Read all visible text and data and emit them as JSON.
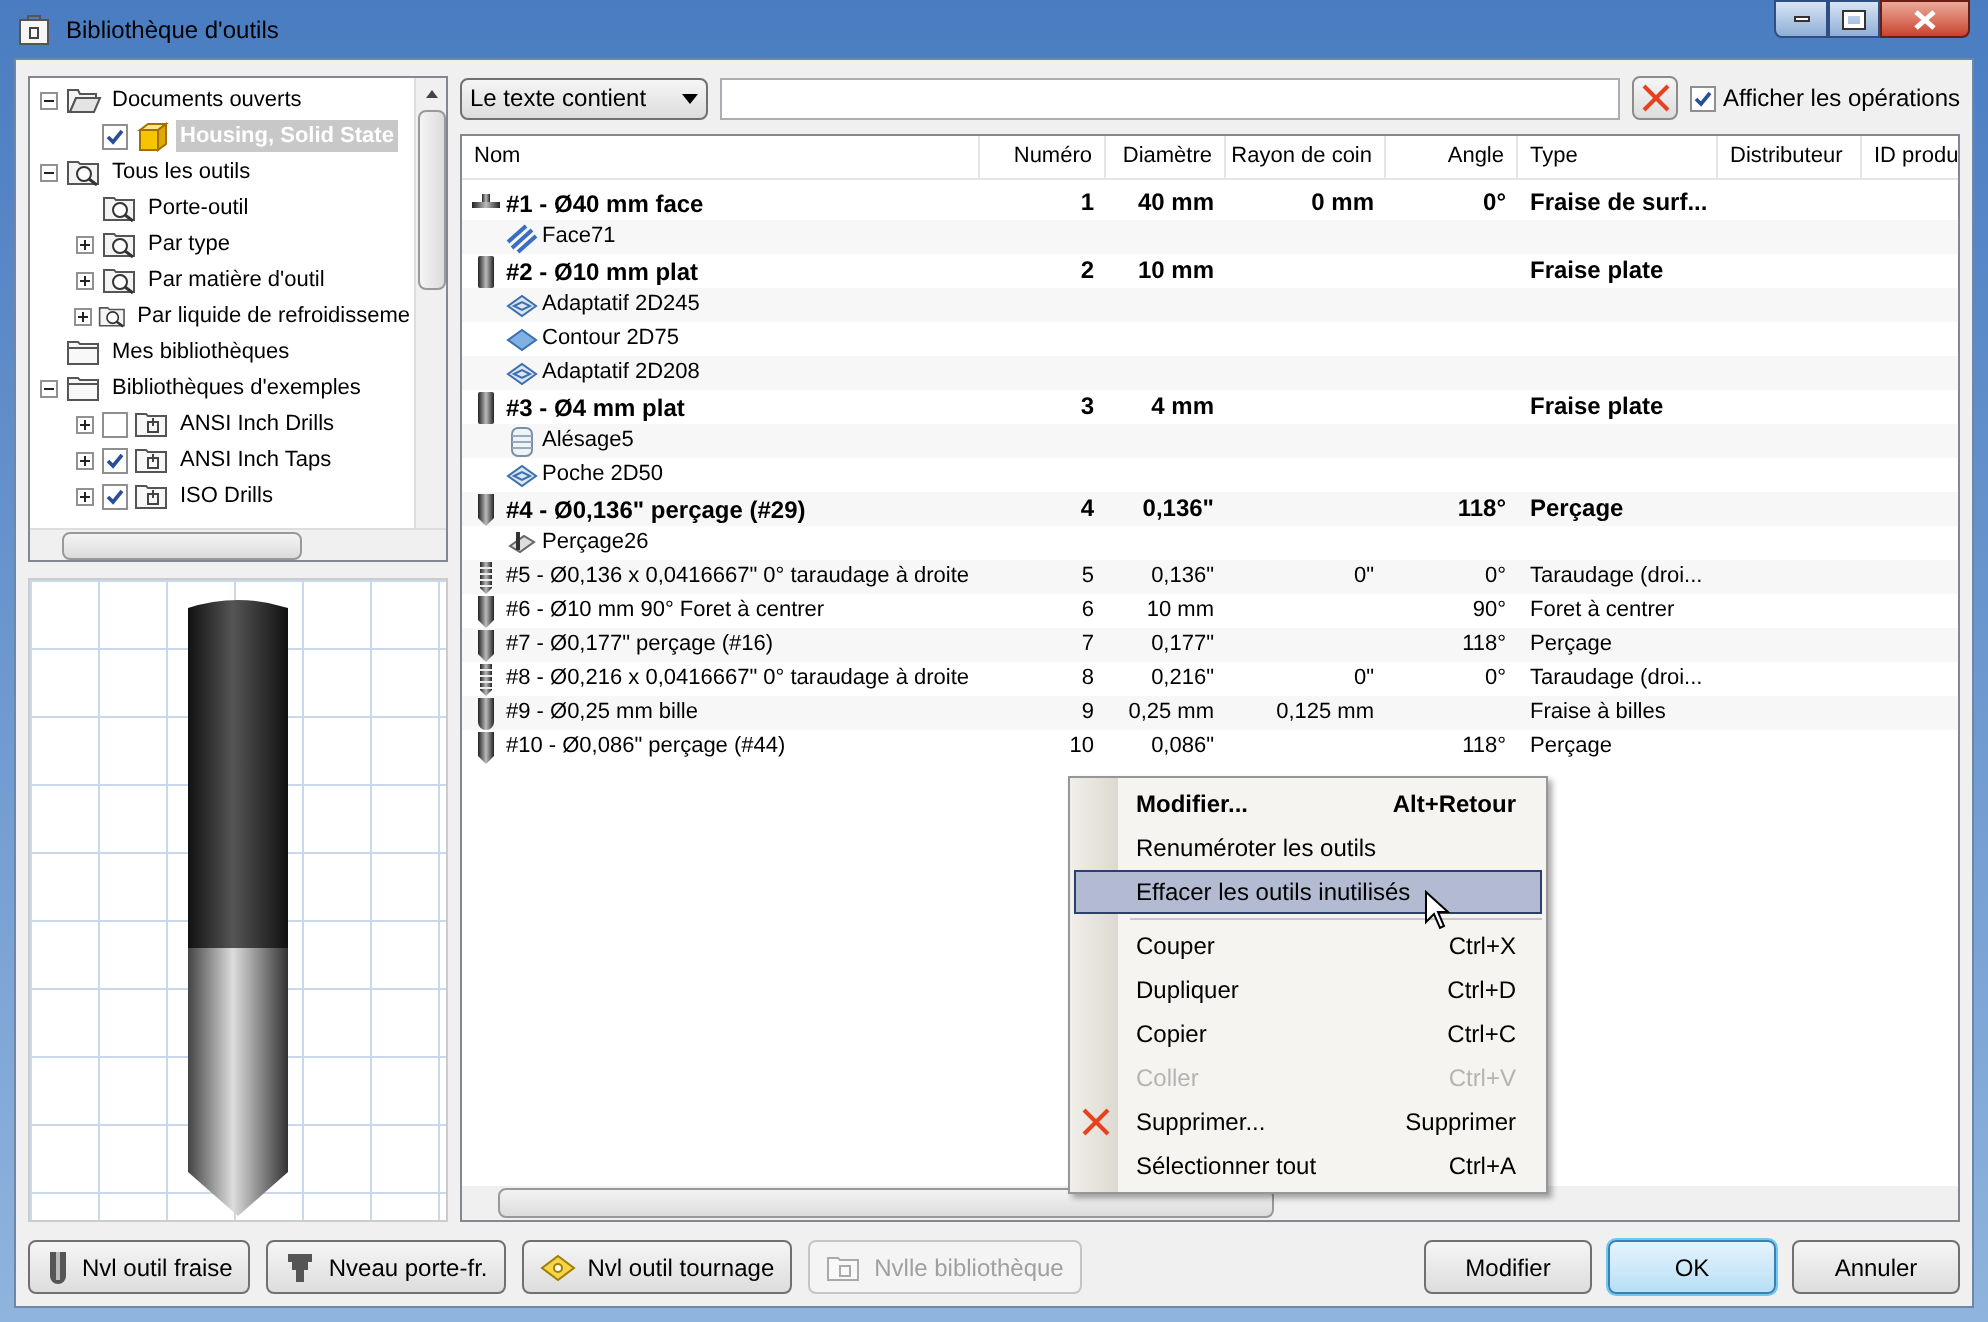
{
  "window": {
    "title": "Bibliothèque d'outils"
  },
  "tree": [
    {
      "label": "Documents ouverts",
      "kind": "open_folder",
      "expanded": true,
      "children": [
        {
          "label": "Housing, Solid State",
          "kind": "part",
          "checked": true,
          "selected": true
        }
      ]
    },
    {
      "label": "Tous les outils",
      "kind": "search_folder",
      "expanded": true,
      "children": [
        {
          "label": "Porte-outil",
          "kind": "search_folder"
        },
        {
          "label": "Par type",
          "kind": "search_folder",
          "expanded": false
        },
        {
          "label": "Par matière d'outil",
          "kind": "search_folder",
          "expanded": false
        },
        {
          "label": "Par liquide de refroidisseme",
          "kind": "search_folder",
          "expanded": false
        }
      ]
    },
    {
      "label": "Mes bibliothèques",
      "kind": "folder"
    },
    {
      "label": "Bibliothèques d'exemples",
      "kind": "folder",
      "expanded": true,
      "children": [
        {
          "label": "ANSI Inch Drills",
          "kind": "library",
          "checked": false,
          "expanded": false
        },
        {
          "label": "ANSI Inch Taps",
          "kind": "library",
          "checked": true,
          "expanded": false
        },
        {
          "label": "ISO Drills",
          "kind": "library",
          "checked": true,
          "expanded": false
        }
      ]
    }
  ],
  "filter": {
    "mode": "Le texte contient",
    "show_operations": {
      "label": "Afficher les opérations",
      "checked": true
    }
  },
  "table": {
    "columns": [
      "Nom",
      "Numéro",
      "Diamètre",
      "Rayon de coin",
      "Angle",
      "Type",
      "Distributeur",
      "ID produ"
    ],
    "rows": [
      {
        "kind": "face_mill",
        "emphasized": true,
        "name": "#1 - Ø40 mm face",
        "number": "1",
        "diameter": "40 mm",
        "corner_radius": "0 mm",
        "angle": "0°",
        "type": "Fraise de surf..."
      },
      {
        "kind": "face_op",
        "name": "Face71"
      },
      {
        "kind": "flat_mill",
        "emphasized": true,
        "name": "#2 - Ø10 mm plat",
        "number": "2",
        "diameter": "10 mm",
        "type": "Fraise plate"
      },
      {
        "kind": "adaptive_op",
        "name": "Adaptatif 2D245"
      },
      {
        "kind": "contour_op",
        "name": "Contour 2D75"
      },
      {
        "kind": "adaptive_op",
        "name": "Adaptatif 2D208"
      },
      {
        "kind": "flat_mill",
        "emphasized": true,
        "name": "#3 - Ø4 mm plat",
        "number": "3",
        "diameter": "4 mm",
        "type": "Fraise plate"
      },
      {
        "kind": "bore_op",
        "name": "Alésage5"
      },
      {
        "kind": "adaptive_op",
        "name": "Poche 2D50"
      },
      {
        "kind": "drill",
        "emphasized": true,
        "name": "#4 - Ø0,136\" perçage (#29)",
        "number": "4",
        "diameter": "0,136\"",
        "angle": "118°",
        "type": "Perçage"
      },
      {
        "kind": "drilling_op",
        "name": "Perçage26"
      },
      {
        "kind": "tap",
        "emphasized": false,
        "name": "#5 - Ø0,136 x 0,0416667\" 0° taraudage à droite",
        "number": "5",
        "diameter": "0,136\"",
        "corner_radius": "0\"",
        "angle": "0°",
        "type": "Taraudage (droi..."
      },
      {
        "kind": "drill",
        "emphasized": false,
        "name": "#6 - Ø10 mm 90° Foret à centrer",
        "number": "6",
        "diameter": "10 mm",
        "angle": "90°",
        "type": "Foret à centrer"
      },
      {
        "kind": "drill",
        "emphasized": false,
        "name": "#7 - Ø0,177\" perçage (#16)",
        "number": "7",
        "diameter": "0,177\"",
        "angle": "118°",
        "type": "Perçage"
      },
      {
        "kind": "tap",
        "emphasized": false,
        "name": "#8 - Ø0,216 x 0,0416667\" 0° taraudage à droite",
        "number": "8",
        "diameter": "0,216\"",
        "corner_radius": "0\"",
        "angle": "0°",
        "type": "Taraudage (droi..."
      },
      {
        "kind": "ball_mill",
        "emphasized": false,
        "name": "#9 - Ø0,25 mm bille",
        "number": "9",
        "diameter": "0,25 mm",
        "corner_radius": "0,125 mm",
        "type": "Fraise à billes"
      },
      {
        "kind": "drill",
        "emphasized": false,
        "name": "#10 - Ø0,086\" perçage (#44)",
        "number": "10",
        "diameter": "0,086\"",
        "angle": "118°",
        "type": "Perçage"
      }
    ]
  },
  "context_menu": [
    {
      "kind": "command",
      "label": "Modifier...",
      "shortcut": "Alt+Retour",
      "default": true,
      "disabled": false,
      "selected": false,
      "separator_after": false
    },
    {
      "kind": "command",
      "label": "Renuméroter les outils",
      "default": false,
      "disabled": false,
      "selected": false,
      "separator_after": false
    },
    {
      "kind": "command",
      "label": "Effacer les outils inutilisés",
      "default": false,
      "disabled": false,
      "selected": true,
      "separator_after": true
    },
    {
      "kind": "command",
      "label": "Couper",
      "shortcut": "Ctrl+X",
      "default": false,
      "disabled": false,
      "selected": false,
      "separator_after": false
    },
    {
      "kind": "command",
      "label": "Dupliquer",
      "shortcut": "Ctrl+D",
      "default": false,
      "disabled": false,
      "selected": false,
      "separator_after": false
    },
    {
      "kind": "command",
      "label": "Copier",
      "shortcut": "Ctrl+C",
      "default": false,
      "disabled": false,
      "selected": false,
      "separator_after": false
    },
    {
      "kind": "command",
      "label": "Coller",
      "shortcut": "Ctrl+V",
      "default": false,
      "disabled": true,
      "selected": false,
      "separator_after": false
    },
    {
      "kind": "delete",
      "label": "Supprimer...",
      "shortcut": "Supprimer",
      "default": false,
      "disabled": false,
      "selected": false,
      "separator_after": false
    },
    {
      "kind": "command",
      "label": "Sélectionner tout",
      "shortcut": "Ctrl+A",
      "default": false,
      "disabled": false,
      "selected": false,
      "separator_after": false
    }
  ],
  "left_buttons": [
    {
      "label": "Nvl outil fraise",
      "kind": "mill",
      "disabled": false
    },
    {
      "label": "Nveau porte-fr.",
      "kind": "holder",
      "disabled": false
    },
    {
      "label": "Nvl outil tournage",
      "kind": "insert",
      "disabled": false
    },
    {
      "label": "Nvlle bibliothèque",
      "kind": "library",
      "disabled": true
    }
  ],
  "right_buttons": [
    {
      "label": "Modifier",
      "default": false
    },
    {
      "label": "OK",
      "default": true
    },
    {
      "label": "Annuler",
      "default": false
    }
  ]
}
